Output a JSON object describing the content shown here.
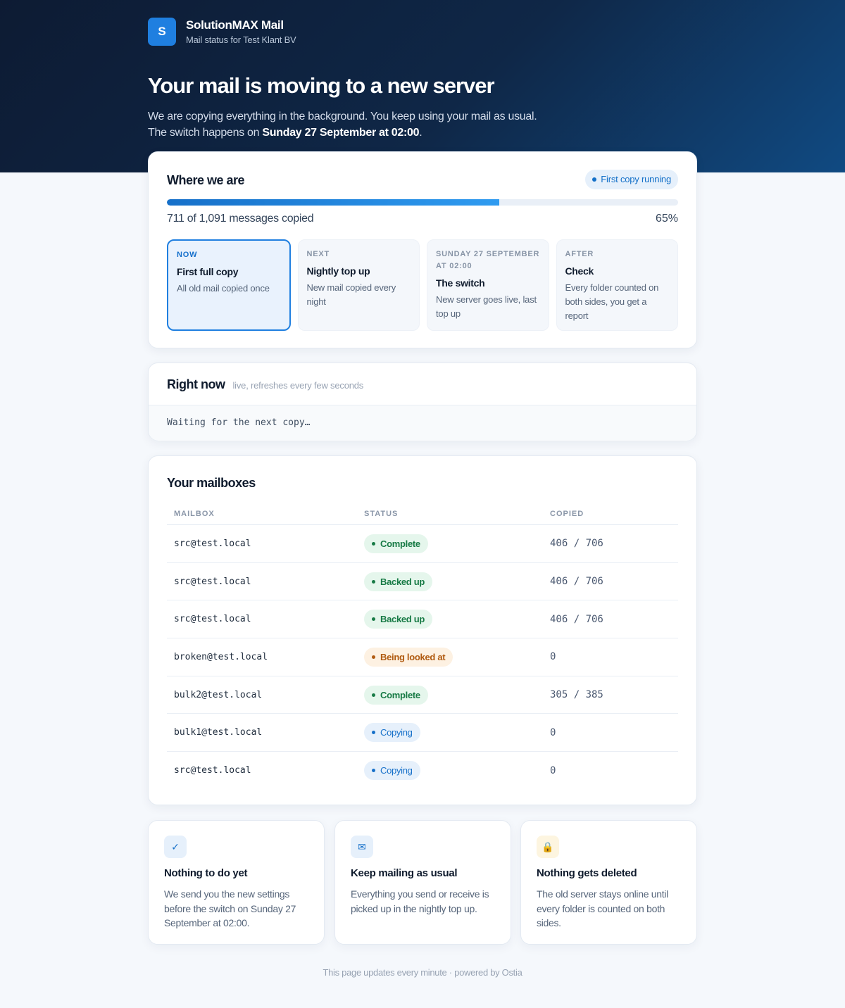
{
  "brand": {
    "logo_letter": "S",
    "name": "SolutionMAX Mail",
    "subtitle": "Mail status for Test Klant BV"
  },
  "hero": {
    "title": "Your mail is moving to a new server",
    "desc_pre": "We are copying everything in the background. You keep using your mail as usual. The switch happens on ",
    "desc_strong": "Sunday 27 September at 02:00",
    "desc_post": "."
  },
  "progress": {
    "title": "Where we are",
    "badge": "First copy running",
    "copied_text": "711 of 1,091 messages copied",
    "percent_text": "65%",
    "percent_value": 0.65,
    "steps": [
      {
        "label": "NOW",
        "title": "First full copy",
        "desc": "All old mail copied once",
        "active": true
      },
      {
        "label": "NEXT",
        "title": "Nightly top up",
        "desc": "New mail copied every night",
        "active": false
      },
      {
        "label": "SUNDAY 27 SEPTEMBER AT 02:00",
        "title": "The switch",
        "desc": "New server goes live, last top up",
        "active": false
      },
      {
        "label": "AFTER",
        "title": "Check",
        "desc": "Every folder counted on both sides, you get a report",
        "active": false
      }
    ]
  },
  "right_now": {
    "title": "Right now",
    "hint": "live, refreshes every few seconds",
    "log": "Waiting for the next copy…"
  },
  "mailboxes": {
    "title": "Your mailboxes",
    "columns": [
      "MAILBOX",
      "STATUS",
      "COPIED"
    ],
    "rows": [
      {
        "mailbox": "src@test.local",
        "status": "Complete",
        "kind": "complete",
        "copied": "406 / 706"
      },
      {
        "mailbox": "src@test.local",
        "status": "Backed up",
        "kind": "backed",
        "copied": "406 / 706"
      },
      {
        "mailbox": "src@test.local",
        "status": "Backed up",
        "kind": "backed",
        "copied": "406 / 706"
      },
      {
        "mailbox": "broken@test.local",
        "status": "Being looked at",
        "kind": "looking",
        "copied": "0"
      },
      {
        "mailbox": "bulk2@test.local",
        "status": "Complete",
        "kind": "complete",
        "copied": "305 / 385"
      },
      {
        "mailbox": "bulk1@test.local",
        "status": "Copying",
        "kind": "copying",
        "copied": "0"
      },
      {
        "mailbox": "src@test.local",
        "status": "Copying",
        "kind": "copying",
        "copied": "0"
      }
    ]
  },
  "info_cards": [
    {
      "icon": "check-icon",
      "glyph": "✓",
      "title": "Nothing to do yet",
      "desc": "We send you the new settings before the switch on Sunday 27 September at 02:00."
    },
    {
      "icon": "envelope-icon",
      "glyph": "✉",
      "title": "Keep mailing as usual",
      "desc": "Everything you send or receive is picked up in the nightly top up."
    },
    {
      "icon": "lock-icon",
      "glyph": "🔒",
      "title": "Nothing gets deleted",
      "desc": "The old server stays online until every folder is counted on both sides."
    }
  ],
  "footer": "This page updates every minute · powered by Ostia",
  "colors": {
    "accent": "#1f7fe0",
    "hero_dark": "#0d1b33",
    "success": "#177a45",
    "warning": "#b05a10"
  }
}
